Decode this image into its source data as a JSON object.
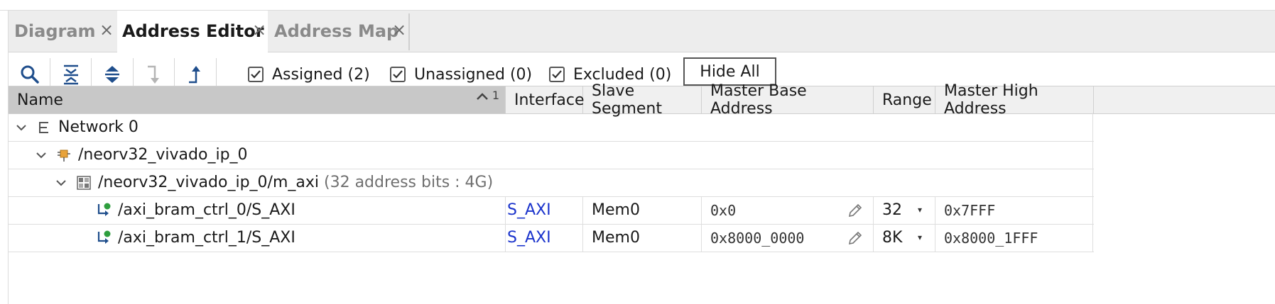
{
  "tabs": [
    {
      "label": "Diagram",
      "close": "×",
      "active": false
    },
    {
      "label": "Address Editor",
      "close": "×",
      "active": true
    },
    {
      "label": "Address Map",
      "close": "×",
      "active": false
    }
  ],
  "toolbar": {
    "buttons": [
      {
        "icon": "search-icon"
      },
      {
        "icon": "collapse-all-icon"
      },
      {
        "icon": "expand-all-icon"
      },
      {
        "icon": "move-down-icon",
        "disabled": true
      },
      {
        "icon": "move-up-icon"
      }
    ],
    "filters": [
      {
        "label": "Assigned (2)",
        "checked": true
      },
      {
        "label": "Unassigned (0)",
        "checked": true
      },
      {
        "label": "Excluded (0)",
        "checked": true
      }
    ],
    "hide_all_label": "Hide All"
  },
  "table": {
    "columns": {
      "name": "Name",
      "sort_indicator": "1",
      "interface": "Interface",
      "slave_segment": "Slave Segment",
      "master_base": "Master Base Address",
      "range": "Range",
      "master_high": "Master High Address"
    },
    "tree": {
      "network": "Network 0",
      "ip": "/neorv32_vivado_ip_0",
      "addr_space": "/neorv32_vivado_ip_0/m_axi",
      "addr_space_note": "(32 address bits : 4G)"
    },
    "rows": [
      {
        "name": "/axi_bram_ctrl_0/S_AXI",
        "interface": "S_AXI",
        "slave_segment": "Mem0",
        "master_base": "0x0",
        "range": "32",
        "master_high": "0x7FFF"
      },
      {
        "name": "/axi_bram_ctrl_1/S_AXI",
        "interface": "S_AXI",
        "slave_segment": "Mem0",
        "master_base": "0x8000_0000",
        "range": "8K",
        "master_high": "0x8000_1FFF"
      }
    ]
  },
  "colors": {
    "link": "#1a33cc",
    "assigned_icon_green": "#2e9e3e",
    "ip_icon_orange": "#e8a33b"
  }
}
